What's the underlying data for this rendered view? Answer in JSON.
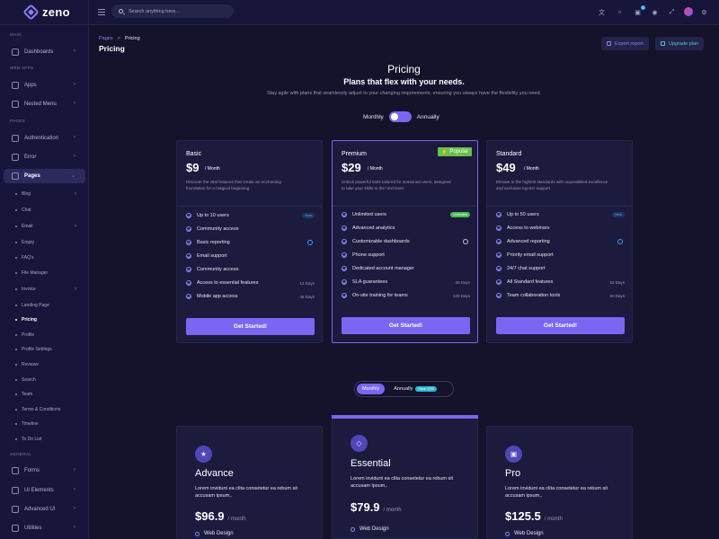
{
  "app": {
    "logo": "zeno"
  },
  "colors": {
    "accent": "#7a66f2",
    "popular": "#6ac04b",
    "unlimited": "#49b94e",
    "save": "#30b8d6",
    "background": "#14132b"
  },
  "sidebar": {
    "sections": {
      "main": "MAIN",
      "web_apps": "WEB APPS",
      "pages": "PAGES",
      "general": "GENERAL"
    },
    "items": {
      "dashboards": "Dashboards",
      "apps": "Apps",
      "nested_menu": "Nested Menu",
      "authentication": "Authentication",
      "error": "Error",
      "pages": "Pages",
      "forms": "Forms",
      "ui_elements": "UI Elements",
      "advanced_ui": "Advanced UI",
      "utilities": "Utilities"
    },
    "subitems": [
      "Blog",
      "Chat",
      "Email",
      "Empty",
      "FAQ's",
      "File Manager",
      "Invoice",
      "Landing Page",
      "Pricing",
      "Profile",
      "Profile Settings",
      "Reviews",
      "Search",
      "Team",
      "Terms & Conditions",
      "Timeline",
      "To Do List"
    ],
    "current_subitem": "Pricing"
  },
  "topbar": {
    "search_placeholder": "Search anything here...",
    "cart_count": "5"
  },
  "header": {
    "breadcrumb_root": "Pages",
    "breadcrumb_sep": ">",
    "breadcrumb_current": "Pricing",
    "title": "Pricing",
    "export_label": "Export report",
    "upgrade_label": "Upgrade plan"
  },
  "pricing": {
    "title": "Pricing",
    "subtitle": "Plans that flex with your needs.",
    "description": "Stay agile with plans that seamlessly adjust to your changing requirements, ensuring you always have the flexibility you need.",
    "toggle_monthly": "Monthly",
    "toggle_annually": "Annually"
  },
  "plans": [
    {
      "name": "Basic",
      "price": "$9",
      "period": "/ Month",
      "description": "Discover the vital features that create an enchanting foundation for a magical beginning.",
      "features": [
        {
          "text": "Up to 10 users",
          "note": "New"
        },
        {
          "text": "Community access",
          "note": ""
        },
        {
          "text": "Basic reporting",
          "note": ""
        },
        {
          "text": "Email support",
          "note": ""
        },
        {
          "text": "Community access",
          "note": ""
        },
        {
          "text": "Access to essential features",
          "note": "12 Days"
        },
        {
          "text": "Mobile app access",
          "note": "45 Days"
        }
      ],
      "cta": "Get Started!"
    },
    {
      "name": "Premium",
      "price": "$29",
      "period": "/ Month",
      "badge": "Popular",
      "description": "Unlock powerful tools tailored for seasoned users, designed to take your skills to the next level.",
      "features": [
        {
          "text": "Unlimited users",
          "note": "Unlimited"
        },
        {
          "text": "Advanced analytics",
          "note": ""
        },
        {
          "text": "Customizable dashboards",
          "note": ""
        },
        {
          "text": "Phone support",
          "note": ""
        },
        {
          "text": "Dedicated account manager",
          "note": ""
        },
        {
          "text": "SLA guarantees",
          "note": "30 Days"
        },
        {
          "text": "On-site training for teams",
          "note": "120 Days"
        }
      ],
      "cta": "Get Started!"
    },
    {
      "name": "Standard",
      "price": "$49",
      "period": "/ Month",
      "description": "Elevate to the highest standards with unparalleled excellence and exclusive top-tier support.",
      "features": [
        {
          "text": "Up to 50 users",
          "note": "New"
        },
        {
          "text": "Access to webinars",
          "note": ""
        },
        {
          "text": "Advanced reporting",
          "note": ""
        },
        {
          "text": "Priority email support",
          "note": ""
        },
        {
          "text": "24/7 chat support",
          "note": ""
        },
        {
          "text": "All Standard features",
          "note": "52 Days"
        },
        {
          "text": "Team collaboration tools",
          "note": "60 Days"
        }
      ],
      "cta": "Get Started!"
    }
  ],
  "toggle2": {
    "monthly": "Monthly",
    "annually": "Annually",
    "save": "Save 10%"
  },
  "bottom_plans": [
    {
      "name": "Advance",
      "icon": "star-icon",
      "description": "Lorem invidunt ea clita consetetur ea rebum sit accusam ipsum,.",
      "price": "$96.9",
      "period": "/ month",
      "feature": "Web Design"
    },
    {
      "name": "Essential",
      "icon": "layers-icon",
      "description": "Lorem invidunt ea clita consetetur ea rebum sit accusam ipsum,.",
      "price": "$79.9",
      "period": "/ month",
      "feature": "Web Design"
    },
    {
      "name": "Pro",
      "icon": "briefcase-icon",
      "description": "Lorem invidunt ea clita consetetur ea rebum sit accusam ipsum,.",
      "price": "$125.5",
      "period": "/ month",
      "feature": "Web Design"
    }
  ]
}
